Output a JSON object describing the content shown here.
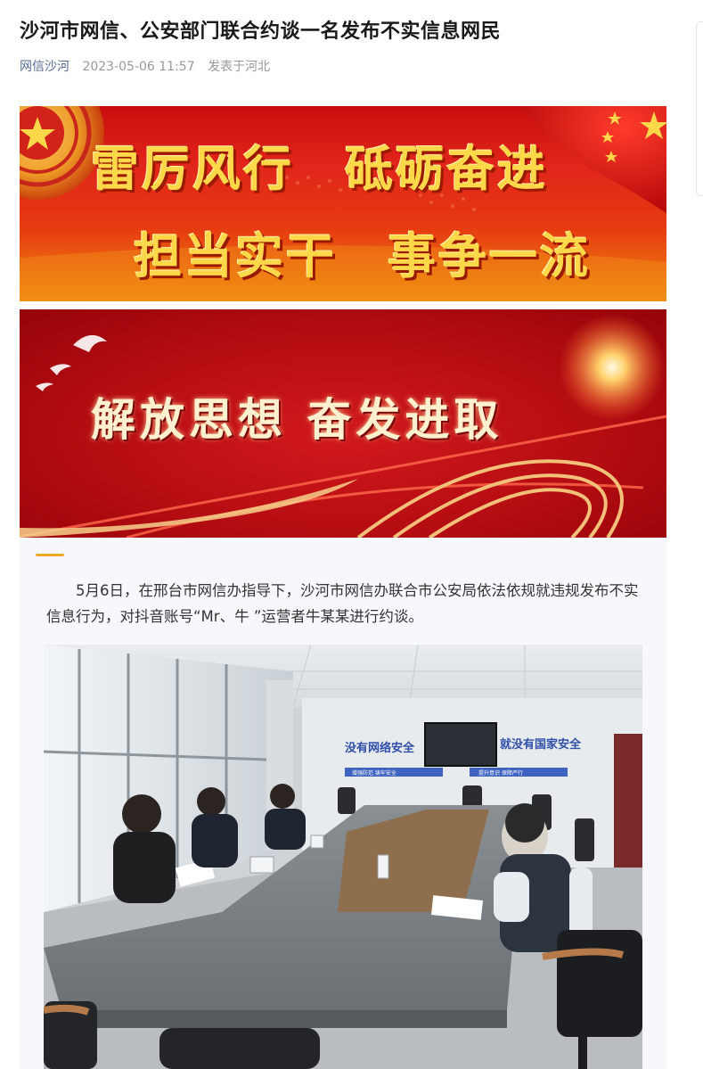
{
  "article": {
    "title": "沙河市网信、公安部门联合约谈一名发布不实信息网民",
    "author": "网信沙河",
    "date": "2023-05-06 11:57",
    "location": "发表于河北"
  },
  "banner1": {
    "line1": "雷厉风行　砥砺奋进",
    "line2": "担当实干　事争一流"
  },
  "banner2": {
    "line": "解放思想 奋发进取"
  },
  "body": {
    "paragraph": "5月6日，在邢台市网信办指导下，沙河市网信办联合市公安局依法依规就违规发布不实信息行为，对抖音账号“Mr、牛 ”运营者牛某某进行约谈。"
  },
  "photo": {
    "wall_slogan_left": "没有网络安全",
    "wall_slogan_right": "就没有国家安全",
    "wall_sub_left": "增强防范 铸牢安全",
    "wall_sub_right": "提升意识 保障严行"
  },
  "colors": {
    "author_link": "#576b95",
    "accent_bar": "#f0a623",
    "banner_red": "#e1251b",
    "banner_gold": "#ffd84a"
  }
}
